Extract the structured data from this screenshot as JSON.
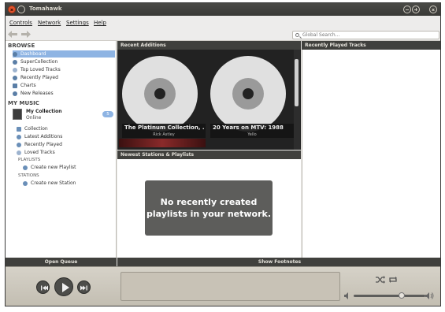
{
  "window": {
    "title": "Tomahawk"
  },
  "menu": [
    "Controls",
    "Network",
    "Settings",
    "Help"
  ],
  "search": {
    "placeholder": "Global Search..."
  },
  "sidebar": {
    "browse_title": "BROWSE",
    "browse_items": [
      "Dashboard",
      "SuperCollection",
      "Top Loved Tracks",
      "Recently Played",
      "Charts",
      "New Releases"
    ],
    "mymusic_title": "MY MUSIC",
    "collection": {
      "name": "My Collection",
      "status": "Online",
      "count": "5"
    },
    "collection_items": [
      "Collection",
      "Latest Additions",
      "Recently Played",
      "Loved Tracks"
    ],
    "playlists_title": "PLAYLISTS",
    "create_playlist": "Create new Playlist",
    "stations_title": "STATIONS",
    "create_station": "Create new Station"
  },
  "panels": {
    "recent_additions": "Recent Additions",
    "newest_stations": "Newest Stations & Playlists",
    "recently_played": "Recently Played Tracks",
    "no_playlists_line1": "No recently created",
    "no_playlists_line2": "playlists in your network."
  },
  "albums": [
    {
      "title": "The Platinum Collection, ...",
      "artist": "Rick Astley"
    },
    {
      "title": "20 Years on MTV: 1988",
      "artist": "Yello"
    }
  ],
  "bottom": {
    "open_queue": "Open Queue",
    "show_footnotes": "Show Footnotes"
  },
  "colors": {
    "header": "#40403d",
    "selection": "#8eb4e3",
    "close": "#e4542d"
  }
}
